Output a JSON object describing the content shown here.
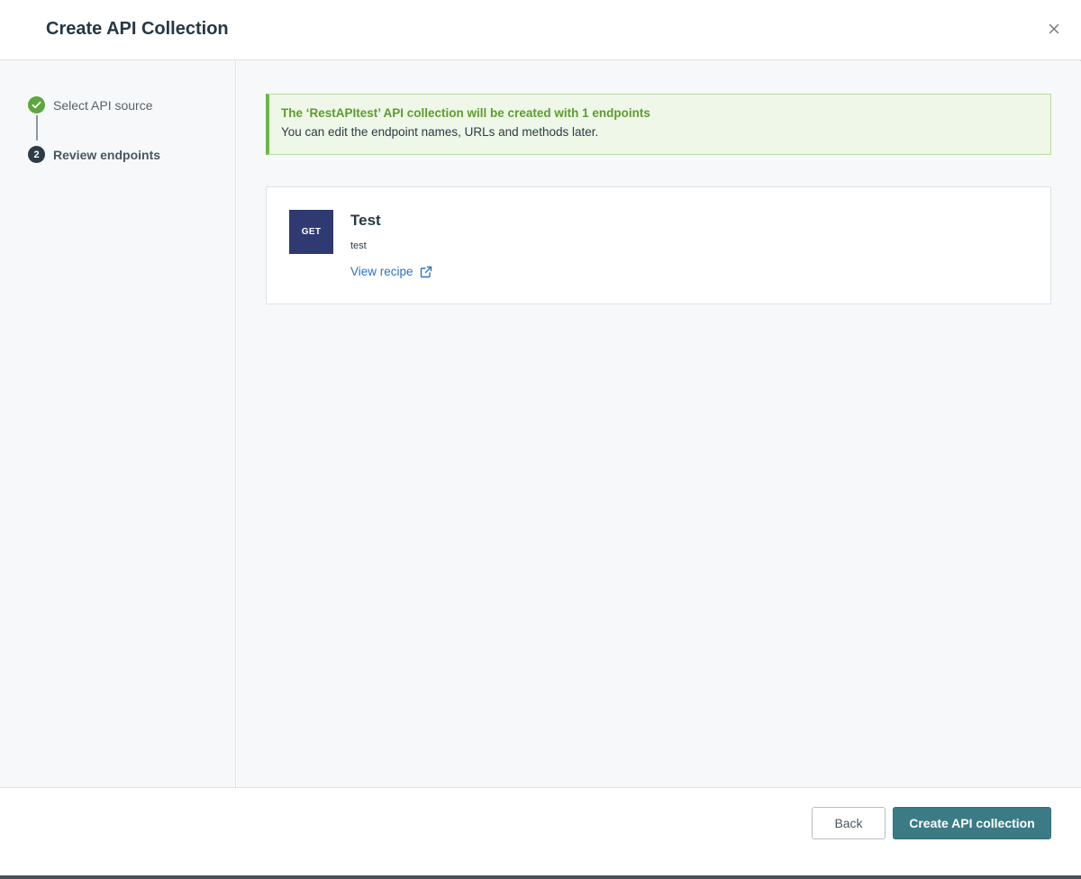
{
  "header": {
    "title": "Create API Collection",
    "close_icon": "close-icon"
  },
  "steps": [
    {
      "number": "1",
      "label": "Select API source",
      "status": "completed",
      "icon": "check-icon"
    },
    {
      "number": "2",
      "label": "Review endpoints",
      "status": "current"
    }
  ],
  "alert": {
    "title": "The ‘RestAPItest’ API collection will be created with 1 endpoints",
    "text": "You can edit the endpoint names, URLs and methods later."
  },
  "endpoints": [
    {
      "method": "GET",
      "name": "Test",
      "path": "test",
      "link_label": "View recipe",
      "link_icon": "external-link-icon"
    }
  ],
  "footer": {
    "back_label": "Back",
    "create_label": "Create API collection"
  },
  "colors": {
    "primary_button": "#3a7b86",
    "success": "#5ba63f",
    "method_badge": "#2f3a72",
    "link": "#2d72c4"
  }
}
